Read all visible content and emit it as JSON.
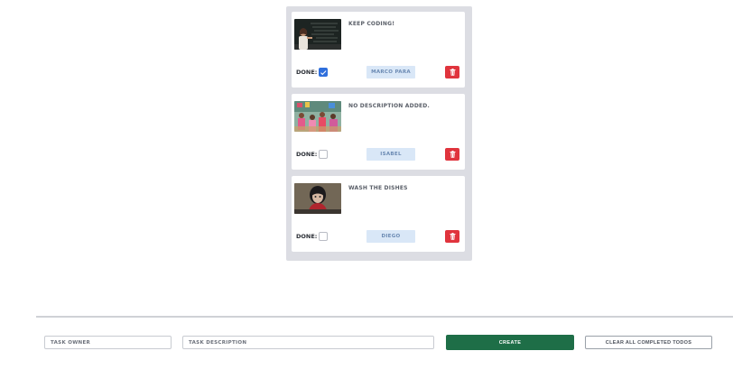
{
  "todos": [
    {
      "description": "Keep coding!",
      "done_label": "DONE:",
      "done": true,
      "owner": "MARCO PARA",
      "image": "teacher-at-chalkboard",
      "delete_icon": "trash-icon"
    },
    {
      "description": "No description added.",
      "done_label": "DONE:",
      "done": false,
      "owner": "ISABEL",
      "image": "colorful-classroom",
      "delete_icon": "trash-icon"
    },
    {
      "description": "Wash the dishes",
      "done_label": "DONE:",
      "done": false,
      "owner": "DIEGO",
      "image": "girl-portrait",
      "delete_icon": "trash-icon"
    }
  ],
  "form": {
    "owner_placeholder": "TASK OWNER",
    "description_placeholder": "TASK DESCRIPTION",
    "create_label": "CREATE",
    "clear_label": "CLEAR ALL COMPLETED TODOS"
  },
  "colors": {
    "panel": "#dcdde3",
    "checkbox_checked": "#2f6fdc",
    "owner_tag": "#d9e7f7",
    "delete": "#e0343d",
    "create": "#1e6e47"
  }
}
